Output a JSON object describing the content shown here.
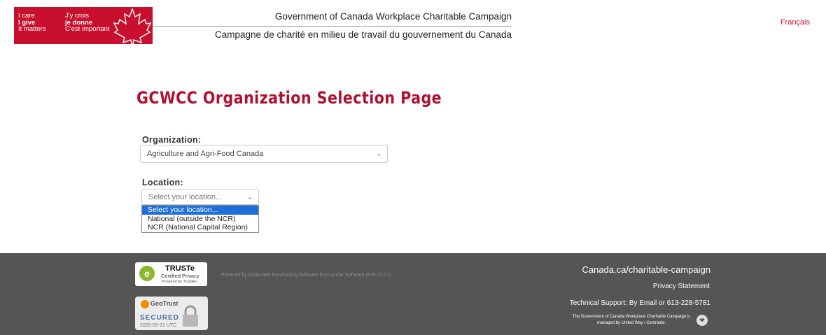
{
  "header": {
    "logo": {
      "en_lines": [
        "I care",
        "I give",
        "It matters"
      ],
      "fr_lines": [
        "J'y crois",
        "je donne",
        "C'est important"
      ]
    },
    "title_en": "Government of Canada Workplace Charitable Campaign",
    "title_fr": "Campagne de charité en milieu de travail du gouvernement du Canada",
    "language_link": "Français"
  },
  "main": {
    "page_title": "GCWCC Organization Selection Page",
    "organization": {
      "label": "Organization:",
      "selected": "Agriculture and Agri-Food Canada"
    },
    "location": {
      "label": "Location:",
      "selected": "Select your location...",
      "options": [
        "Select your location...",
        "National (outside the NCR)",
        "NCR (National Capital Region)"
      ]
    }
  },
  "footer": {
    "truste": {
      "title": "TRUSTe",
      "subtitle": "Certified Privacy",
      "powered": "Powered by TrustArc"
    },
    "powered_by": "Powered by Andar/360 Fundraising Software from Andar Software (e20.02.01)",
    "geotrust": {
      "name": "GeoTrust",
      "secured": "SECURED",
      "date": "2020-09-21 UTC"
    },
    "canada_link": "Canada.ca/charitable-campaign",
    "privacy_link": "Privacy Statement",
    "support_text": "Technical Support: By Email or 613-228-5781",
    "managed_text": "The Government of Canada Workplace Charitable Campaign is managed by United Way / Centraide."
  },
  "colors": {
    "brand_red": "#c8102e",
    "title_red": "#b01030",
    "footer_bg": "#555555",
    "selected_option": "#1e6fd9"
  }
}
